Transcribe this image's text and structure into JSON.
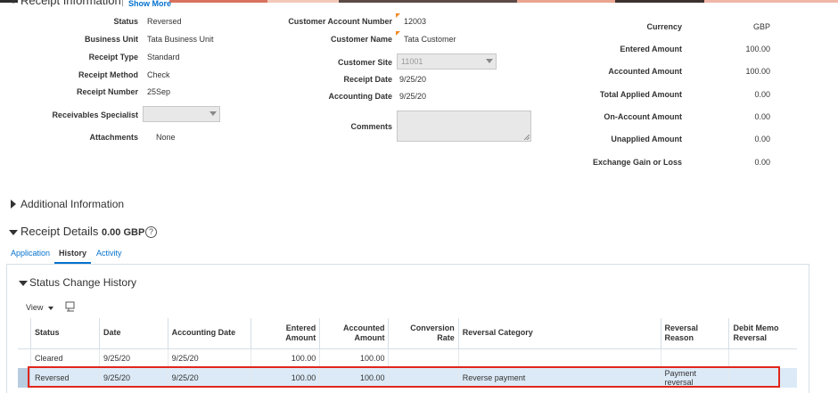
{
  "receipt_info": {
    "title": "Receipt Information",
    "show_more": "Show More",
    "left": [
      {
        "label": "Status",
        "value": "Reversed"
      },
      {
        "label": "Business Unit",
        "value": "Tata Business Unit"
      },
      {
        "label": "Receipt Type",
        "value": "Standard"
      },
      {
        "label": "Receipt Method",
        "value": "Check"
      },
      {
        "label": "Receipt Number",
        "value": "25Sep"
      }
    ],
    "receivables_specialist_label": "Receivables Specialist",
    "receivables_specialist_value": "",
    "attachments_label": "Attachments",
    "attachments_value": "None",
    "middle": {
      "customer_account_number_label": "Customer Account Number",
      "customer_account_number": "12003",
      "customer_name_label": "Customer Name",
      "customer_name": "Tata Customer",
      "customer_site_label": "Customer Site",
      "customer_site": "11001",
      "receipt_date_label": "Receipt Date",
      "receipt_date": "9/25/20",
      "accounting_date_label": "Accounting Date",
      "accounting_date": "9/25/20",
      "comments_label": "Comments",
      "comments": ""
    },
    "right": [
      {
        "label": "Currency",
        "value": "GBP"
      },
      {
        "label": "Entered Amount",
        "value": "100.00"
      },
      {
        "label": "Accounted Amount",
        "value": "100.00"
      },
      {
        "label": "Total Applied Amount",
        "value": "0.00"
      },
      {
        "label": "On-Account Amount",
        "value": "0.00"
      },
      {
        "label": "Unapplied Amount",
        "value": "0.00"
      },
      {
        "label": "Exchange Gain or Loss",
        "value": "0.00"
      }
    ]
  },
  "additional_info": {
    "title": "Additional Information"
  },
  "receipt_details": {
    "title": "Receipt Details",
    "amount": "0.00 GBP",
    "help": "?",
    "tabs": [
      "Application",
      "History",
      "Activity"
    ],
    "active_tab": 1
  },
  "status_history": {
    "title": "Status Change History",
    "view_label": "View",
    "columns": [
      "Status",
      "Date",
      "Accounting Date",
      "Entered Amount",
      "Accounted Amount",
      "Conversion Rate",
      "Reversal Category",
      "Reversal Reason",
      "Debit Memo Reversal"
    ],
    "rows": [
      [
        "Cleared",
        "9/25/20",
        "9/25/20",
        "100.00",
        "100.00",
        "",
        "",
        "",
        ""
      ],
      [
        "Reversed",
        "9/25/20",
        "9/25/20",
        "100.00",
        "100.00",
        "",
        "Reverse payment",
        "Payment reversal",
        ""
      ]
    ]
  },
  "colors": {
    "link": "#0572ce",
    "highlight": "#e1261c",
    "selected_row": "#dceaf7"
  }
}
